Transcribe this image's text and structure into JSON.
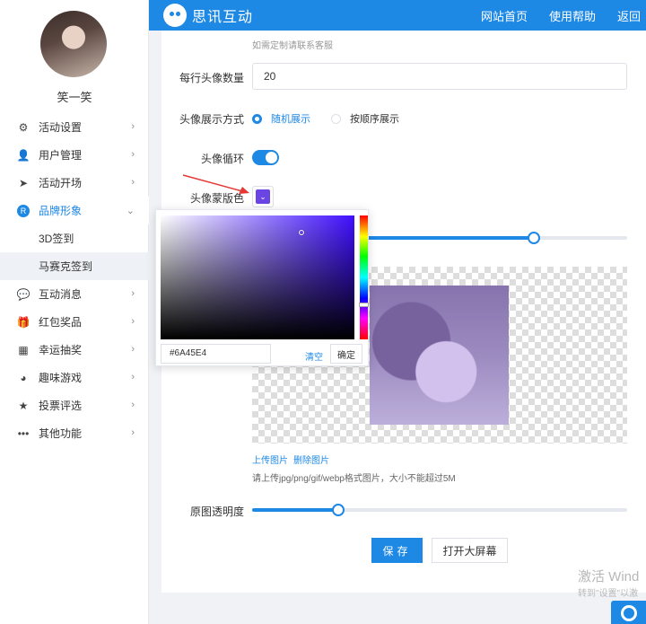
{
  "header": {
    "brand": "思讯互动",
    "nav": [
      "网站首页",
      "使用帮助",
      "返回"
    ]
  },
  "user": {
    "name": "笑一笑"
  },
  "menu": {
    "items": [
      {
        "label": "活动设置",
        "icon": "gears-icon"
      },
      {
        "label": "用户管理",
        "icon": "user-icon"
      },
      {
        "label": "活动开场",
        "icon": "send-icon"
      },
      {
        "label": "品牌形象",
        "icon": "brand-icon"
      },
      {
        "label": "互动消息",
        "icon": "message-icon"
      },
      {
        "label": "红包奖品",
        "icon": "gift-icon"
      },
      {
        "label": "幸运抽奖",
        "icon": "lottery-icon"
      },
      {
        "label": "趣味游戏",
        "icon": "game-icon"
      },
      {
        "label": "投票评选",
        "icon": "star-icon"
      },
      {
        "label": "其他功能",
        "icon": "more-icon"
      }
    ],
    "sub": [
      "3D签到",
      "马赛克签到"
    ]
  },
  "form": {
    "top_hint": "如需定制请联系客服",
    "per_row_label": "每行头像数量",
    "per_row_value": "20",
    "display_mode_label": "头像展示方式",
    "mode_random": "随机展示",
    "mode_order": "按顺序展示",
    "loop_label": "头像循环",
    "mask_color_label": "头像蒙版色",
    "mask_opacity": 0.75,
    "upload_label": "上传图片",
    "delete_label": "删除图片",
    "upload_tip": "请上传jpg/png/gif/webp格式图片，大小不能超过5M",
    "opacity_label": "原图透明度",
    "opacity_value": 0.23,
    "save": "保存",
    "big_screen": "打开大屏幕"
  },
  "picker": {
    "hex": "#6A45E4",
    "clear": "清空",
    "confirm": "确定"
  },
  "watermark": {
    "line1": "激活 Wind",
    "line2": "转到\"设置\"以激"
  },
  "colors": {
    "accent": "#1e88e5",
    "mask": "#6a45e4"
  }
}
